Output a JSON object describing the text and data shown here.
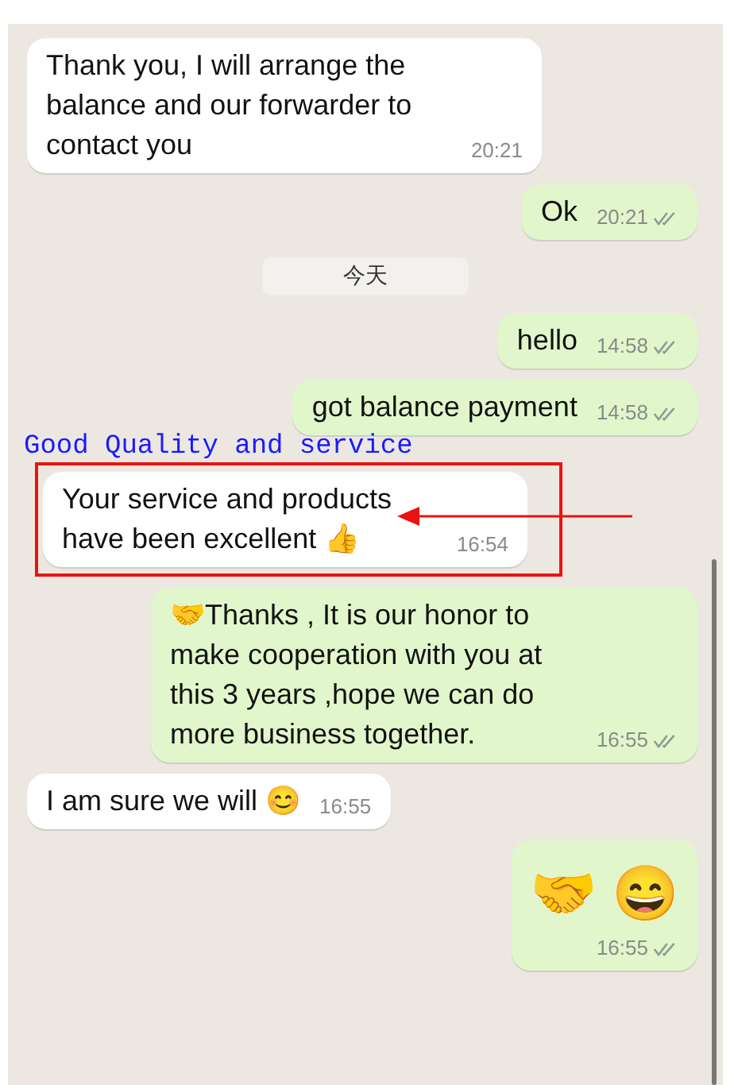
{
  "messages": [
    {
      "kind": "incoming",
      "text": "Thank you, I will arrange the balance and our forwarder to contact you",
      "time": "20:21"
    },
    {
      "kind": "outgoing",
      "text": "Ok",
      "time": "20:21",
      "delivered": true
    },
    {
      "kind": "date",
      "text": "今天"
    },
    {
      "kind": "outgoing",
      "text": "hello",
      "time": "14:58",
      "delivered": true
    },
    {
      "kind": "outgoing",
      "text": "got balance payment",
      "time": "14:58",
      "delivered": true
    },
    {
      "kind": "incoming",
      "text": "Your service and products have been excellent 👍",
      "time": "16:54",
      "highlighted": true
    },
    {
      "kind": "outgoing",
      "text": "🤝Thanks , It is our honor to make cooperation with you at this 3 years ,hope we can do more business together.",
      "time": "16:55",
      "delivered": true
    },
    {
      "kind": "incoming",
      "text": "I am sure we will 😊",
      "time": "16:55"
    },
    {
      "kind": "outgoing",
      "text": "🤝 😄",
      "time": "16:55",
      "delivered": true,
      "big": true
    }
  ],
  "annotation": {
    "label": "Good Quality and service"
  }
}
